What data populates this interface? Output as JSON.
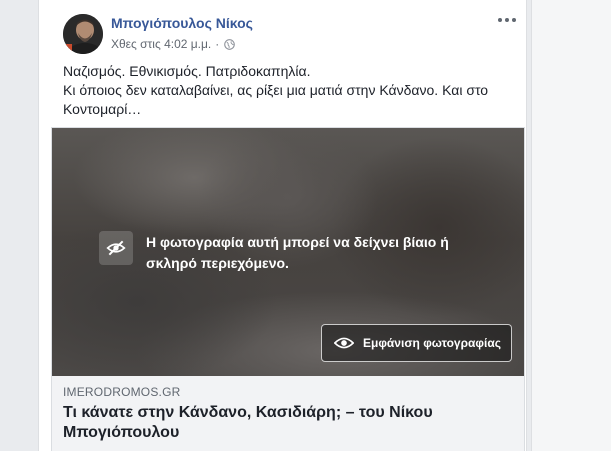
{
  "post": {
    "author": "Μπογιόπουλος Νίκος",
    "timestamp": "Χθες στις 4:02 μ.μ.",
    "separator": "·",
    "privacy_icon": "globe-icon",
    "more_icon": "more-options-icon",
    "text_line1": "Ναζισμός. Εθνικισμός. Πατριδοκαπηλία.",
    "text_line2": "Κι όποιος δεν καταλαβαίνει, ας ρίξει μια ματιά στην Κάνδανο. Και στο Κοντομαρί…"
  },
  "attachment": {
    "warning_text": "Η φωτογραφία αυτή μπορεί να δείχνει βίαιο ή σκληρό περιεχόμενο.",
    "warning_icon": "eye-slash-icon",
    "show_button_label": "Εμφάνιση φωτογραφίας",
    "show_button_icon": "eye-icon",
    "domain": "IMERODROMOS.GR",
    "title": "Τι κάνατε στην Κάνδανο, Κασιδιάρη; – του Νίκου Μπογιόπουλου"
  },
  "colors": {
    "author_link": "#385898",
    "page_bg": "#e9ebee",
    "link_footer_bg": "#f2f3f5"
  }
}
